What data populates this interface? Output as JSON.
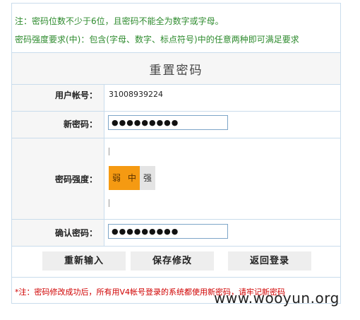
{
  "notices": {
    "note1": "注：密码位数不少于6位，且密码不能全为数字或字母。",
    "note2": "密码强度要求(中)：包含(字母、数字、标点符号)中的任意两种即可满足要求"
  },
  "title": "重置密码",
  "fields": {
    "account_label": "用户帐号：",
    "account_value": "31008939224",
    "new_password_label": "新密码：",
    "new_password_value": "●●●●●●●●●",
    "strength_label": "密码强度：",
    "confirm_label": "确认密码：",
    "confirm_value": "●●●●●●●●●"
  },
  "strength": {
    "levels": [
      "弱",
      "中",
      "强"
    ],
    "current": "中",
    "active_color": "#f59a12",
    "inactive_color": "#e4e4e4"
  },
  "buttons": {
    "reset": "重新输入",
    "save": "保存修改",
    "back": "返回登录"
  },
  "warning": "*注：密码修改成功后，所有用V4帐号登录的系统都使用新密码，请牢记新密码",
  "watermark": "www.wooyun.org"
}
